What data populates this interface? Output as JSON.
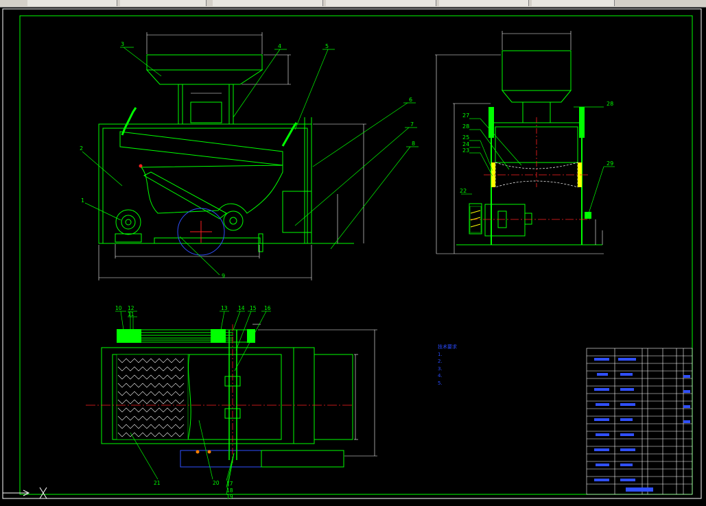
{
  "toolbar": {
    "cells": [
      "",
      "",
      "",
      "",
      "",
      "",
      ""
    ]
  },
  "labels": {
    "front_view": [
      "1",
      "2",
      "3",
      "4",
      "5",
      "6",
      "7",
      "8",
      "9"
    ],
    "side_view": [
      "27",
      "28",
      "25",
      "24",
      "23",
      "22",
      "28",
      "29"
    ],
    "top_view": [
      "10",
      "12",
      "11",
      "13",
      "14",
      "15",
      "16",
      "21",
      "20",
      "17",
      "18",
      "19"
    ]
  },
  "tech_notes": {
    "title": "技术要求",
    "lines": [
      "1.",
      "",
      "2.",
      "3.",
      "4.",
      "5."
    ]
  },
  "colors": {
    "outline": "#00ff00",
    "frame": "#ffffff",
    "dim": "#ffffff",
    "leader": "#00ff00",
    "centerline": "#ff2020",
    "note": "#2a4bff",
    "titleblock": "#ffffff"
  }
}
